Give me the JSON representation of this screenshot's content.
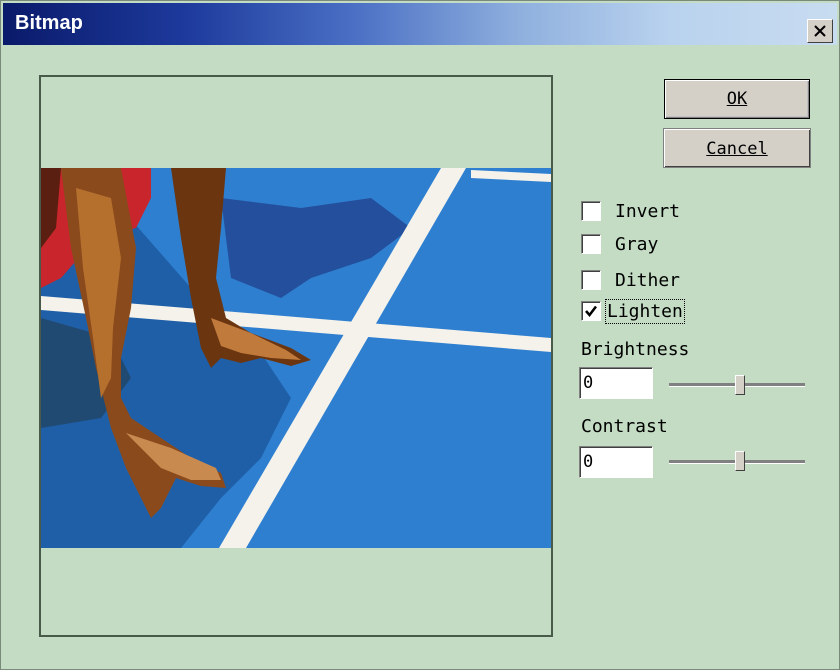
{
  "window": {
    "title": "Bitmap"
  },
  "buttons": {
    "ok_label": "OK",
    "cancel_label": "Cancel"
  },
  "options": [
    {
      "label": "Invert",
      "checked": false
    },
    {
      "label": "Gray",
      "checked": false
    },
    {
      "label": "Dither",
      "checked": false
    },
    {
      "label": "Lighten",
      "checked": true
    }
  ],
  "brightness": {
    "label": "Brightness",
    "value": "0",
    "slider_level": 0.52
  },
  "contrast": {
    "label": "Contrast",
    "value": "0",
    "slider_level": 0.52
  },
  "colors": {
    "dialog_bg": "#c3dcc3",
    "court_blue": "#2f7fd0",
    "line_white": "#f4f2ea"
  }
}
